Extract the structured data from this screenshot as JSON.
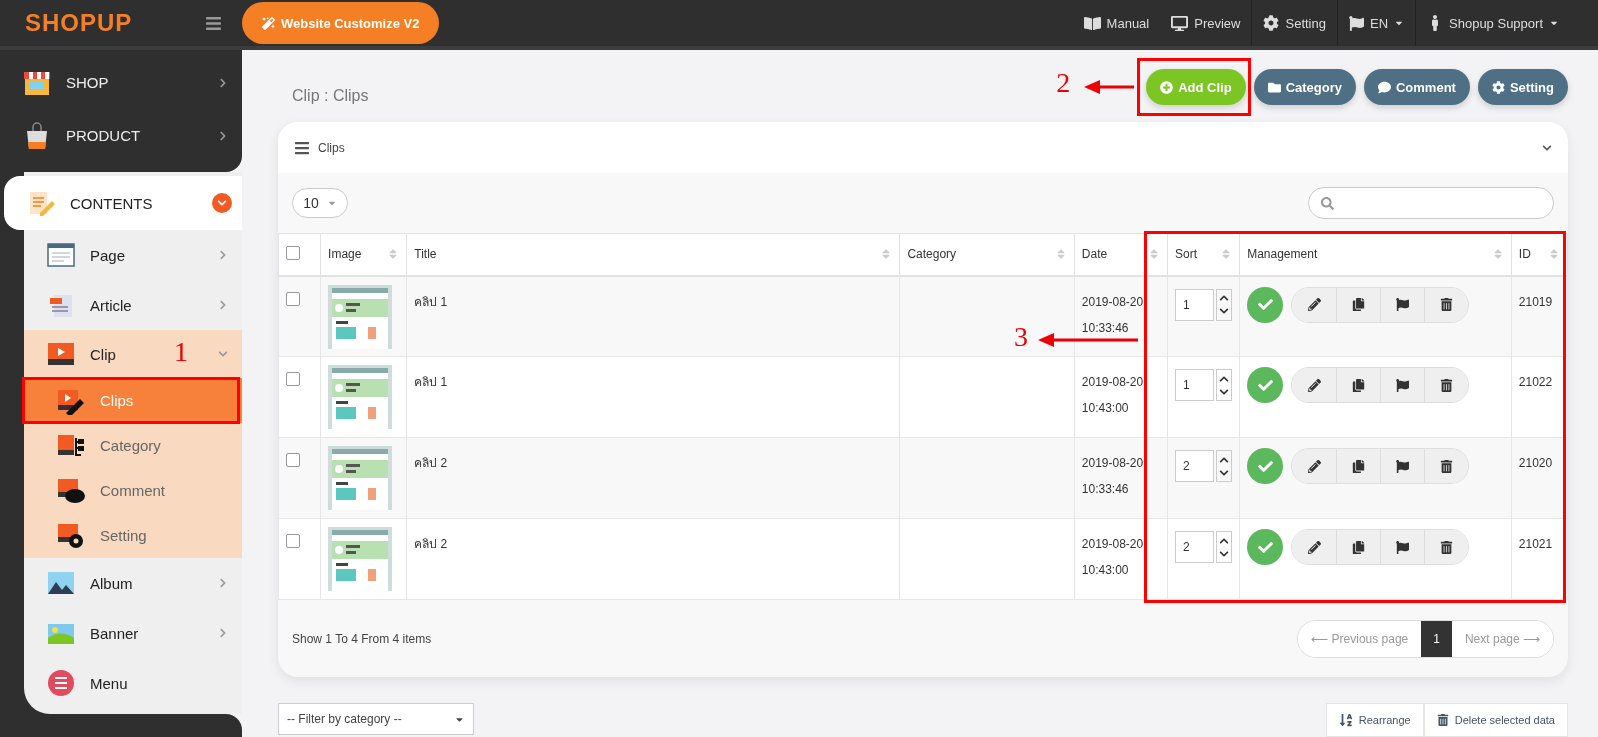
{
  "topbar": {
    "logo": "SHOPUP",
    "customize_button": "Website Customize V2",
    "links": [
      {
        "label": "Manual",
        "kind": "book",
        "dropdown": false
      },
      {
        "label": "Preview",
        "kind": "monitor",
        "dropdown": false
      },
      {
        "label": "Setting",
        "kind": "gear",
        "dropdown": false
      },
      {
        "label": "EN",
        "kind": "flag",
        "dropdown": true
      },
      {
        "label": "Shopup Support",
        "kind": "person",
        "dropdown": true
      }
    ]
  },
  "sidebar": {
    "top_items": [
      {
        "label": "SHOP",
        "kind": "shop",
        "expanded": false
      },
      {
        "label": "PRODUCT",
        "kind": "product",
        "expanded": false
      }
    ],
    "section": {
      "label": "CONTENTS",
      "kind": "contents",
      "expanded": true,
      "children": [
        {
          "label": "Page",
          "kind": "page",
          "expanded": false
        },
        {
          "label": "Article",
          "kind": "article",
          "expanded": false
        },
        {
          "label": "Clip",
          "kind": "clip",
          "expanded": true,
          "children": [
            {
              "label": "Clips",
              "kind": "clips",
              "selected": true
            },
            {
              "label": "Category",
              "kind": "category",
              "selected": false
            },
            {
              "label": "Comment",
              "kind": "comment",
              "selected": false
            },
            {
              "label": "Setting",
              "kind": "setting",
              "selected": false
            }
          ]
        },
        {
          "label": "Album",
          "kind": "album",
          "expanded": false
        },
        {
          "label": "Banner",
          "kind": "banner",
          "expanded": false
        },
        {
          "label": "Menu",
          "kind": "menu"
        }
      ]
    }
  },
  "breadcrumb": "Clip : Clips",
  "actions": [
    {
      "label": "Add Clip",
      "kind": "add"
    },
    {
      "label": "Category",
      "kind": "folder"
    },
    {
      "label": "Comment",
      "kind": "comment"
    },
    {
      "label": "Setting",
      "kind": "gear"
    }
  ],
  "panel": {
    "title": "Clips",
    "expanded": true,
    "page_size": "10",
    "table": {
      "select_all": false,
      "columns": [
        "Image",
        "Title",
        "Category",
        "Date",
        "Sort",
        "Management",
        "ID"
      ],
      "rows": [
        {
          "checked": false,
          "title": "คลิป 1",
          "date": "2019-08-20",
          "time": "10:33:46",
          "sort": "1",
          "published": true,
          "id": "21019"
        },
        {
          "checked": false,
          "title": "คลิป 1",
          "date": "2019-08-20",
          "time": "10:43:00",
          "sort": "1",
          "published": true,
          "id": "21022"
        },
        {
          "checked": false,
          "title": "คลิป 2",
          "date": "2019-08-20",
          "time": "10:33:46",
          "sort": "2",
          "published": true,
          "id": "21020"
        },
        {
          "checked": false,
          "title": "คลิป 2",
          "date": "2019-08-20",
          "time": "10:43:00",
          "sort": "2",
          "published": true,
          "id": "21021"
        }
      ]
    },
    "summary": "Show 1 To 4 From 4 items",
    "pagination": {
      "previous": "⟵ Previous page",
      "pages": [
        {
          "label": "1",
          "selected": true
        }
      ],
      "next": "Next page ⟶"
    }
  },
  "bottom": {
    "filter": "-- Filter by category --",
    "buttons": [
      {
        "label": "Rearrange",
        "kind": "sort"
      },
      {
        "label": "Delete selected data",
        "kind": "trash"
      }
    ]
  },
  "annotations": [
    "1",
    "2",
    "3"
  ]
}
